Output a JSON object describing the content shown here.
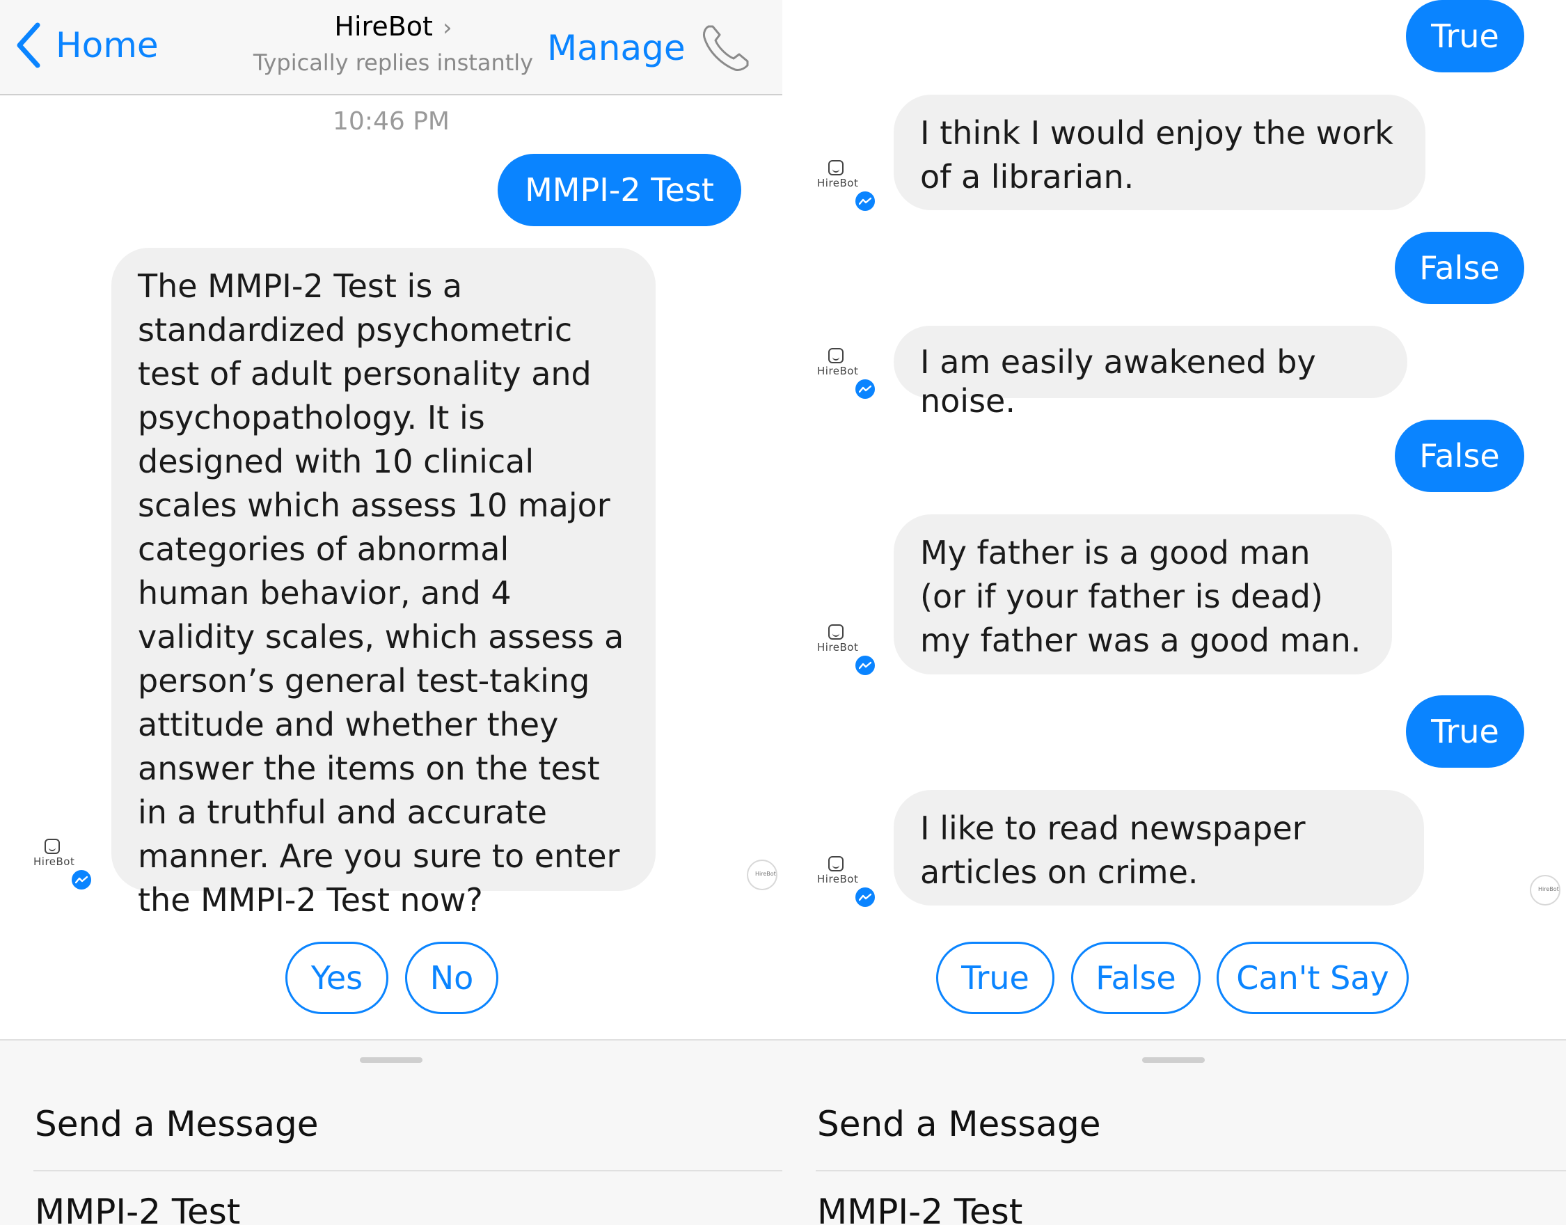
{
  "left": {
    "nav": {
      "back_label": "Home",
      "title": "HireBot",
      "subtitle": "Typically replies instantly",
      "manage_label": "Manage"
    },
    "timestamp": "10:46 PM",
    "outgoing": "MMPI-2 Test",
    "incoming": "The MMPI-2 Test is a standardized psychometric test of adult personality and psychopathology. It is designed with 10 clinical scales which assess 10 major categories of abnormal human behavior, and 4 validity scales, which assess a person’s general test-taking attitude and whether they answer the items on the test in a truthful and accurate manner. Are you sure to enter the MMPI-2 Test now?",
    "quick_replies": [
      "Yes",
      "No"
    ],
    "composer": {
      "send_label": "Send a Message",
      "menu_item": "MMPI-2 Test"
    }
  },
  "right": {
    "messages": [
      {
        "type": "out",
        "text": "True"
      },
      {
        "type": "in",
        "text": "I think I would enjoy the work of a librarian."
      },
      {
        "type": "out",
        "text": "False"
      },
      {
        "type": "in",
        "text": "I am easily awakened by noise."
      },
      {
        "type": "out",
        "text": "False"
      },
      {
        "type": "in",
        "text": "My father is a good man (or if your father is dead) my father was a good man."
      },
      {
        "type": "out",
        "text": "True"
      },
      {
        "type": "in",
        "text": "I like to read newspaper articles on crime."
      }
    ],
    "quick_replies": [
      "True",
      "False",
      "Can't Say"
    ],
    "composer": {
      "send_label": "Send a Message",
      "menu_item": "MMPI-2 Test"
    }
  },
  "avatar_label": "HireBot",
  "icons": [
    "chevron-left-icon",
    "chevron-right-icon",
    "phone-icon",
    "messenger-badge-icon",
    "bot-face-icon"
  ],
  "colors": {
    "accent": "#0a84ff",
    "bubble_in": "#f0f0f0",
    "nav_bg": "#f7f7f7"
  }
}
